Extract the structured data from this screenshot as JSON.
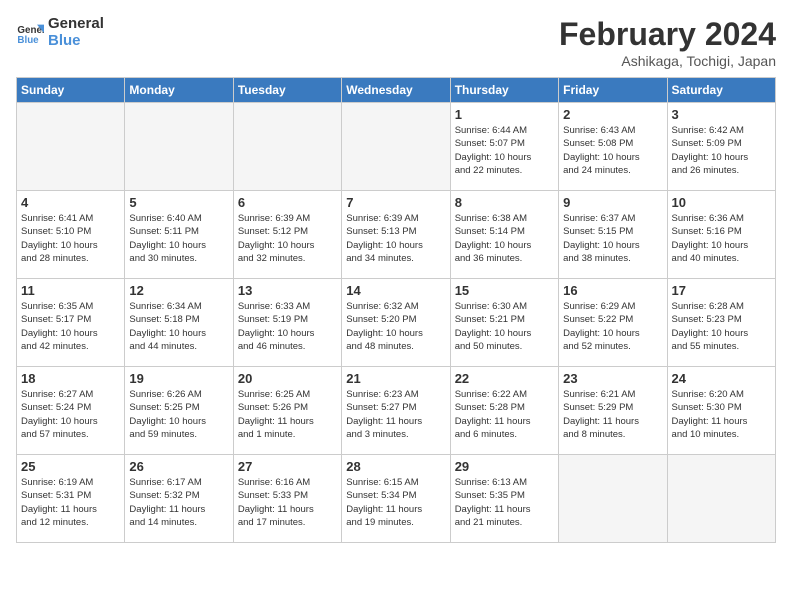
{
  "logo": {
    "line1": "General",
    "line2": "Blue"
  },
  "title": "February 2024",
  "location": "Ashikaga, Tochigi, Japan",
  "weekdays": [
    "Sunday",
    "Monday",
    "Tuesday",
    "Wednesday",
    "Thursday",
    "Friday",
    "Saturday"
  ],
  "weeks": [
    [
      {
        "day": "",
        "info": ""
      },
      {
        "day": "",
        "info": ""
      },
      {
        "day": "",
        "info": ""
      },
      {
        "day": "",
        "info": ""
      },
      {
        "day": "1",
        "info": "Sunrise: 6:44 AM\nSunset: 5:07 PM\nDaylight: 10 hours\nand 22 minutes."
      },
      {
        "day": "2",
        "info": "Sunrise: 6:43 AM\nSunset: 5:08 PM\nDaylight: 10 hours\nand 24 minutes."
      },
      {
        "day": "3",
        "info": "Sunrise: 6:42 AM\nSunset: 5:09 PM\nDaylight: 10 hours\nand 26 minutes."
      }
    ],
    [
      {
        "day": "4",
        "info": "Sunrise: 6:41 AM\nSunset: 5:10 PM\nDaylight: 10 hours\nand 28 minutes."
      },
      {
        "day": "5",
        "info": "Sunrise: 6:40 AM\nSunset: 5:11 PM\nDaylight: 10 hours\nand 30 minutes."
      },
      {
        "day": "6",
        "info": "Sunrise: 6:39 AM\nSunset: 5:12 PM\nDaylight: 10 hours\nand 32 minutes."
      },
      {
        "day": "7",
        "info": "Sunrise: 6:39 AM\nSunset: 5:13 PM\nDaylight: 10 hours\nand 34 minutes."
      },
      {
        "day": "8",
        "info": "Sunrise: 6:38 AM\nSunset: 5:14 PM\nDaylight: 10 hours\nand 36 minutes."
      },
      {
        "day": "9",
        "info": "Sunrise: 6:37 AM\nSunset: 5:15 PM\nDaylight: 10 hours\nand 38 minutes."
      },
      {
        "day": "10",
        "info": "Sunrise: 6:36 AM\nSunset: 5:16 PM\nDaylight: 10 hours\nand 40 minutes."
      }
    ],
    [
      {
        "day": "11",
        "info": "Sunrise: 6:35 AM\nSunset: 5:17 PM\nDaylight: 10 hours\nand 42 minutes."
      },
      {
        "day": "12",
        "info": "Sunrise: 6:34 AM\nSunset: 5:18 PM\nDaylight: 10 hours\nand 44 minutes."
      },
      {
        "day": "13",
        "info": "Sunrise: 6:33 AM\nSunset: 5:19 PM\nDaylight: 10 hours\nand 46 minutes."
      },
      {
        "day": "14",
        "info": "Sunrise: 6:32 AM\nSunset: 5:20 PM\nDaylight: 10 hours\nand 48 minutes."
      },
      {
        "day": "15",
        "info": "Sunrise: 6:30 AM\nSunset: 5:21 PM\nDaylight: 10 hours\nand 50 minutes."
      },
      {
        "day": "16",
        "info": "Sunrise: 6:29 AM\nSunset: 5:22 PM\nDaylight: 10 hours\nand 52 minutes."
      },
      {
        "day": "17",
        "info": "Sunrise: 6:28 AM\nSunset: 5:23 PM\nDaylight: 10 hours\nand 55 minutes."
      }
    ],
    [
      {
        "day": "18",
        "info": "Sunrise: 6:27 AM\nSunset: 5:24 PM\nDaylight: 10 hours\nand 57 minutes."
      },
      {
        "day": "19",
        "info": "Sunrise: 6:26 AM\nSunset: 5:25 PM\nDaylight: 10 hours\nand 59 minutes."
      },
      {
        "day": "20",
        "info": "Sunrise: 6:25 AM\nSunset: 5:26 PM\nDaylight: 11 hours\nand 1 minute."
      },
      {
        "day": "21",
        "info": "Sunrise: 6:23 AM\nSunset: 5:27 PM\nDaylight: 11 hours\nand 3 minutes."
      },
      {
        "day": "22",
        "info": "Sunrise: 6:22 AM\nSunset: 5:28 PM\nDaylight: 11 hours\nand 6 minutes."
      },
      {
        "day": "23",
        "info": "Sunrise: 6:21 AM\nSunset: 5:29 PM\nDaylight: 11 hours\nand 8 minutes."
      },
      {
        "day": "24",
        "info": "Sunrise: 6:20 AM\nSunset: 5:30 PM\nDaylight: 11 hours\nand 10 minutes."
      }
    ],
    [
      {
        "day": "25",
        "info": "Sunrise: 6:19 AM\nSunset: 5:31 PM\nDaylight: 11 hours\nand 12 minutes."
      },
      {
        "day": "26",
        "info": "Sunrise: 6:17 AM\nSunset: 5:32 PM\nDaylight: 11 hours\nand 14 minutes."
      },
      {
        "day": "27",
        "info": "Sunrise: 6:16 AM\nSunset: 5:33 PM\nDaylight: 11 hours\nand 17 minutes."
      },
      {
        "day": "28",
        "info": "Sunrise: 6:15 AM\nSunset: 5:34 PM\nDaylight: 11 hours\nand 19 minutes."
      },
      {
        "day": "29",
        "info": "Sunrise: 6:13 AM\nSunset: 5:35 PM\nDaylight: 11 hours\nand 21 minutes."
      },
      {
        "day": "",
        "info": ""
      },
      {
        "day": "",
        "info": ""
      }
    ]
  ]
}
